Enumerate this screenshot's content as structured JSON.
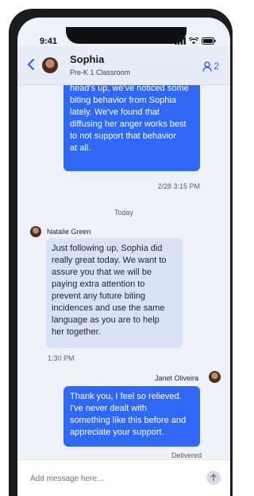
{
  "status_bar": {
    "time": "9:41"
  },
  "header": {
    "name": "Sophia",
    "subtitle": "Pre-K 1 Classroom",
    "member_count": "2"
  },
  "messages": {
    "m1": {
      "lines": [
        "head's up, we've noticed some",
        "biting behavior from Sophia",
        "lately. We've found that",
        "diffusing her anger works best",
        "to not support that behavior",
        "at all."
      ],
      "timestamp": "2/28 3:15 PM"
    },
    "divider": "Today",
    "m2": {
      "sender": "Natalie Green",
      "lines": [
        "Just following up, Sophia did",
        "really great today. We want to",
        "assure you that we will be",
        "paying extra attention to",
        "prevent any future biting",
        "incidences and use the same",
        "language as you are to help",
        "her together."
      ],
      "timestamp": "1:30 PM"
    },
    "m3": {
      "sender": "Janet Oliveira",
      "lines": [
        "Thank you, I feel so relieved.",
        "I've never dealt with",
        "something like this before and",
        "appreciate your support."
      ],
      "status": "Delivered"
    }
  },
  "composer": {
    "placeholder": "Add message here..."
  },
  "colors": {
    "accent": "#2f68f5",
    "incoming_bubble": "#d9e1f6",
    "background": "#eef1f8"
  },
  "icons": {
    "back": "chevron-left-icon",
    "members": "person-icon",
    "send": "arrow-up-icon",
    "signal": "signal-icon",
    "wifi": "wifi-icon",
    "battery": "battery-icon"
  }
}
